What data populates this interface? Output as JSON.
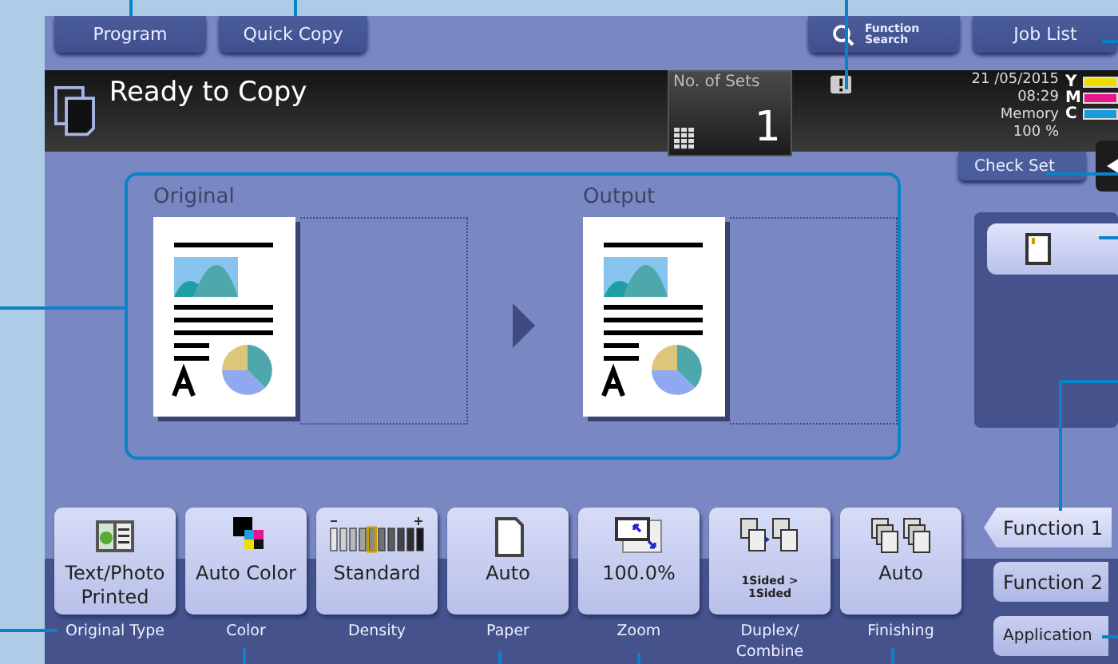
{
  "top_buttons": [
    {
      "label": "Program"
    },
    {
      "label": "Quick Copy"
    }
  ],
  "function_search": {
    "label": "Function Search"
  },
  "job_list": {
    "label": "Job List"
  },
  "status": {
    "title": "Ready to Copy",
    "sets_label": "No. of Sets",
    "sets_value": "1",
    "date": "21 /05/2015",
    "time": "08:29",
    "memory_label": "Memory",
    "memory_value": "100 %"
  },
  "toner": [
    {
      "label": "Y",
      "color": "#f2dc00"
    },
    {
      "label": "M",
      "color": "#e6178c"
    },
    {
      "label": "C",
      "color": "#1a9be0"
    }
  ],
  "check_set": {
    "label": "Check Set"
  },
  "preview": {
    "original_label": "Original",
    "output_label": "Output"
  },
  "settings": [
    {
      "kind": "original_type",
      "value": "Text/Photo Printed",
      "caption": "Original Type"
    },
    {
      "kind": "color",
      "value": "Auto Color",
      "caption": "Color"
    },
    {
      "kind": "density",
      "value": "Standard",
      "caption": "Density",
      "level": 0.44
    },
    {
      "kind": "paper",
      "value": "Auto",
      "caption": "Paper"
    },
    {
      "kind": "zoom",
      "value": "100.0%",
      "caption": "Zoom"
    },
    {
      "kind": "duplex",
      "value": "1Sided > 1Sided",
      "caption": "Duplex/ Combine"
    },
    {
      "kind": "finishing",
      "value": "Auto",
      "caption": "Finishing"
    }
  ],
  "side_tabs": [
    {
      "label": "Function 1",
      "selected": true
    },
    {
      "label": "Function 2",
      "selected": false
    },
    {
      "label": "Application",
      "selected": false
    }
  ]
}
